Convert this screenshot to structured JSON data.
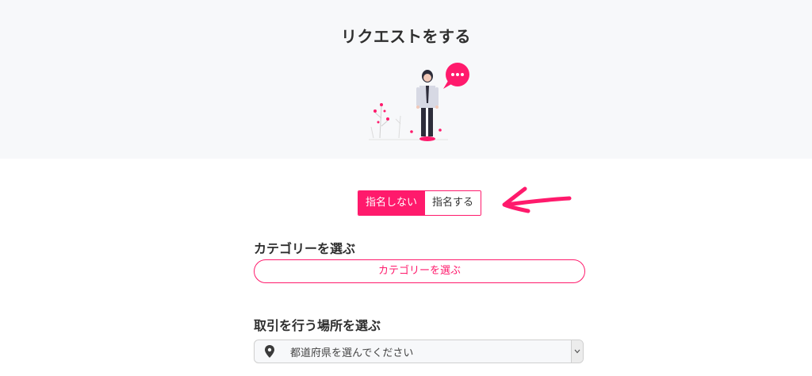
{
  "header": {
    "title": "リクエストをする"
  },
  "designation_toggle": {
    "options": [
      "指名しない",
      "指名する"
    ],
    "selected": "指名しない"
  },
  "category": {
    "label": "カテゴリーを選ぶ",
    "button_label": "カテゴリーを選ぶ"
  },
  "location": {
    "label": "取引を行う場所を選ぶ",
    "select_value": "都道府県を選んでください"
  },
  "colors": {
    "accent": "#ff1a6c",
    "hero_background": "#f7f8fa"
  },
  "icons": {
    "location": "map-pin-icon",
    "dropdown": "chevron-down-icon",
    "annotation": "arrow-left-icon"
  }
}
